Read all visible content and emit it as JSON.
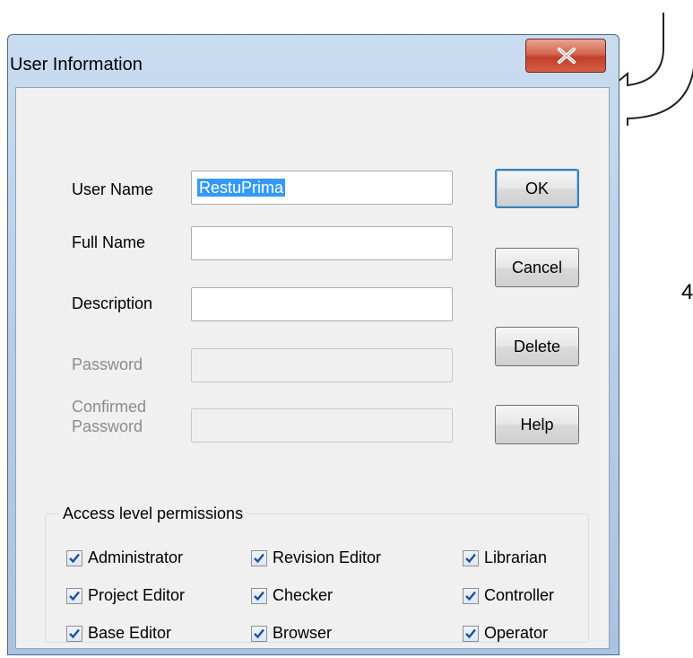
{
  "window": {
    "title": "User Information"
  },
  "icons": {
    "close": "close-x-icon",
    "checkbox": "checkmark-icon",
    "annotation": "curved-arrow-icon"
  },
  "form": {
    "user_name_label": "User Name",
    "user_name_value": "RestuPrima",
    "full_name_label": "Full Name",
    "full_name_value": "",
    "description_label": "Description",
    "description_value": "",
    "password_label": "Password",
    "confirmed_password_label_1": "Confirmed",
    "confirmed_password_label_2": "Password"
  },
  "buttons": {
    "ok": "OK",
    "cancel": "Cancel",
    "delete": "Delete",
    "help": "Help"
  },
  "permissions": {
    "title": "Access level permissions",
    "items": [
      {
        "label": "Administrator",
        "checked": true
      },
      {
        "label": "Revision Editor",
        "checked": true
      },
      {
        "label": "Librarian",
        "checked": true
      },
      {
        "label": "Project Editor",
        "checked": true
      },
      {
        "label": "Checker",
        "checked": true
      },
      {
        "label": "Controller",
        "checked": true
      },
      {
        "label": "Base Editor",
        "checked": true
      },
      {
        "label": "Browser",
        "checked": true
      },
      {
        "label": "Operator",
        "checked": true
      }
    ]
  },
  "annotation": {
    "number": "4"
  },
  "colors": {
    "title_bar": "#b9d1ea",
    "close_button": "#c7432c",
    "selection": "#3399ff",
    "dialog_bg": "#f0f0f0"
  }
}
